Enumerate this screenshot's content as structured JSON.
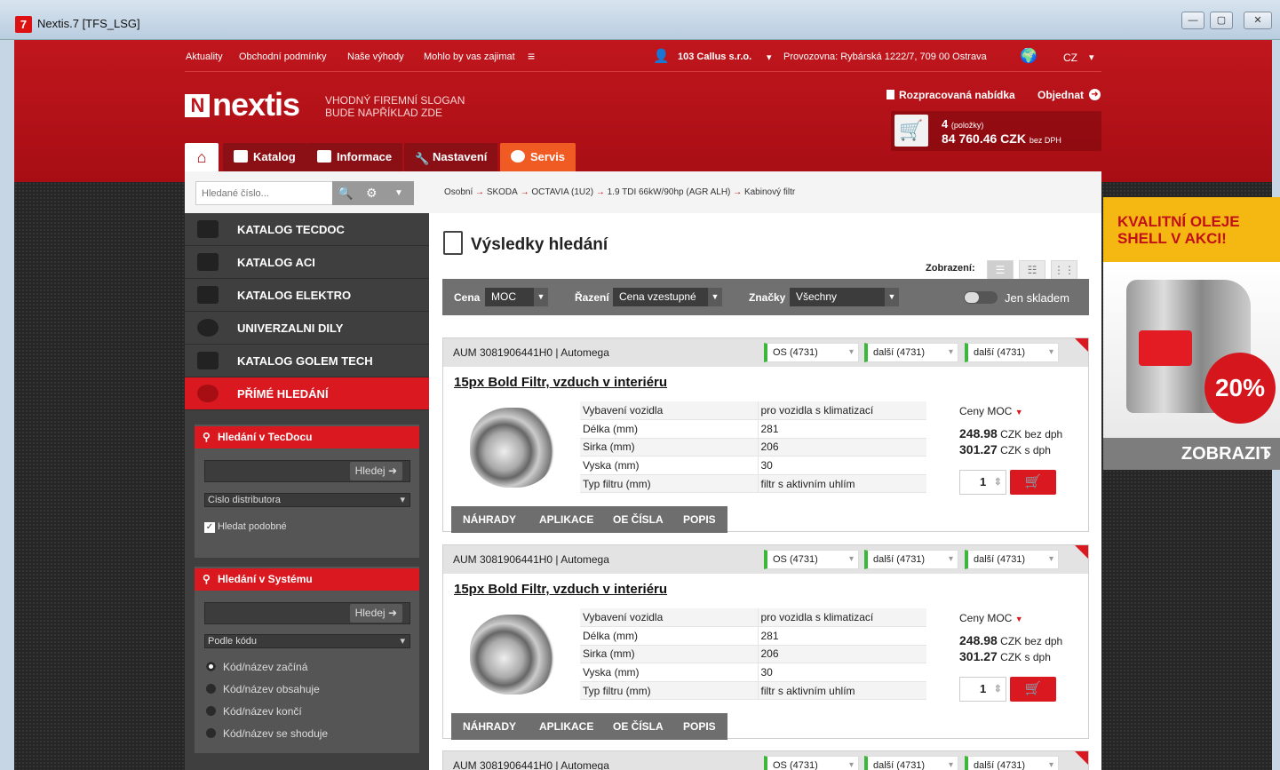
{
  "window": {
    "title": "Nextis.7 [TFS_LSG]",
    "icon_label": "7"
  },
  "topnav": {
    "links": [
      "Aktuality",
      "Obchodní podmínky",
      "Naše výhody",
      "Mohlo by vas zajimat"
    ],
    "company": "103 Callus s.r.o.",
    "branch": "Provozovna: Rybárská 1222/7, 709 00 Ostrava",
    "lang": "CZ"
  },
  "header": {
    "logo": "nextis",
    "slogan_line1": "VHODNÝ FIREMNÍ SLOGAN",
    "slogan_line2": "BUDE NAPŘÍKLAD ZDE",
    "rozpracovana": "Rozpracovaná nabídka",
    "objednat": "Objednat",
    "cart_count": "4",
    "cart_count_unit": "(položky)",
    "cart_total": "84 760.46 CZK",
    "cart_total_suffix": "bez DPH"
  },
  "tabs": [
    "Katalog",
    "Informace",
    "Nastavení",
    "Servis"
  ],
  "search": {
    "placeholder": "Hledané číslo..."
  },
  "breadcrumb": [
    "Osobní",
    "SKODA",
    "OCTAVIA (1U2)",
    "1.9 TDI 66kW/90hp (AGR ALH)",
    "Kabinový filtr"
  ],
  "sidebar": {
    "items": [
      "KATALOG TECDOC",
      "KATALOG ACI",
      "KATALOG ELEKTRO",
      "UNIVERZALNI DILY",
      "KATALOG GOLEM TECH",
      "PŘÍMÉ HLEDÁNÍ"
    ],
    "tecdoc": {
      "title": "Hledání v TecDocu",
      "button": "Hledej",
      "select": "Cislo distributora",
      "checkbox": "Hledat podobné"
    },
    "system": {
      "title": "Hledání v Systému",
      "button": "Hledej",
      "select": "Podle kódu",
      "radios": [
        "Kód/název začíná",
        "Kód/název obsahuje",
        "Kód/název končí",
        "Kód/název se shoduje"
      ]
    }
  },
  "main": {
    "title": "Výsledky hledání",
    "view_label": "Zobrazení:",
    "filters": {
      "cena_label": "Cena",
      "cena_value": "MOC",
      "razeni_label": "Řazení",
      "razeni_value": "Cena vzestupné",
      "znacky_label": "Značky",
      "znacky_value": "Všechny",
      "stock_label": "Jen skladem"
    },
    "products": [
      {
        "header": "AUM 3081906441H0 | Automega",
        "stock": [
          "OS (4731)",
          "další (4731)",
          "další (4731)"
        ],
        "title": "15px Bold Filtr, vzduch v interiéru",
        "specs": [
          [
            "Vybavení vozidla",
            "pro vozidla s klimatizací"
          ],
          [
            "Délka (mm)",
            "281"
          ],
          [
            "Sirka (mm)",
            "206"
          ],
          [
            "Vyska (mm)",
            "30"
          ],
          [
            "Typ filtru (mm)",
            "filtr s aktivním uhlím"
          ]
        ],
        "price_label": "Ceny MOC",
        "price_net": "248.98",
        "price_net_suffix": "CZK bez dph",
        "price_gross": "301.27",
        "price_gross_suffix": "CZK s dph",
        "qty": "1",
        "tabs": [
          "NÁHRADY",
          "APLIKACE",
          "OE ČÍSLA",
          "POPIS"
        ]
      },
      {
        "header": "AUM 3081906441H0 | Automega",
        "stock": [
          "OS (4731)",
          "další (4731)",
          "další (4731)"
        ],
        "title": "15px Bold Filtr, vzduch v interiéru",
        "specs": [
          [
            "Vybavení vozidla",
            "pro vozidla s klimatizací"
          ],
          [
            "Délka (mm)",
            "281"
          ],
          [
            "Sirka (mm)",
            "206"
          ],
          [
            "Vyska (mm)",
            "30"
          ],
          [
            "Typ filtru (mm)",
            "filtr s aktivním uhlím"
          ]
        ],
        "price_label": "Ceny MOC",
        "price_net": "248.98",
        "price_net_suffix": "CZK bez dph",
        "price_gross": "301.27",
        "price_gross_suffix": "CZK s dph",
        "qty": "1",
        "tabs": [
          "NÁHRADY",
          "APLIKACE",
          "OE ČÍSLA",
          "POPIS"
        ]
      },
      {
        "header": "AUM 3081906441H0 | Automega",
        "stock": [
          "OS (4731)",
          "další (4731)",
          "další (4731)"
        ]
      }
    ]
  },
  "ad": {
    "line1": "KVALITNÍ OLEJE",
    "line2": "SHELL V AKCI!",
    "badge": "20%",
    "footer": "ZOBRAZIT"
  },
  "colors": {
    "brand_red": "#c0161d",
    "accent_orange": "#f05a23",
    "stock_green": "#3db73b",
    "ad_yellow": "#f5b813"
  }
}
